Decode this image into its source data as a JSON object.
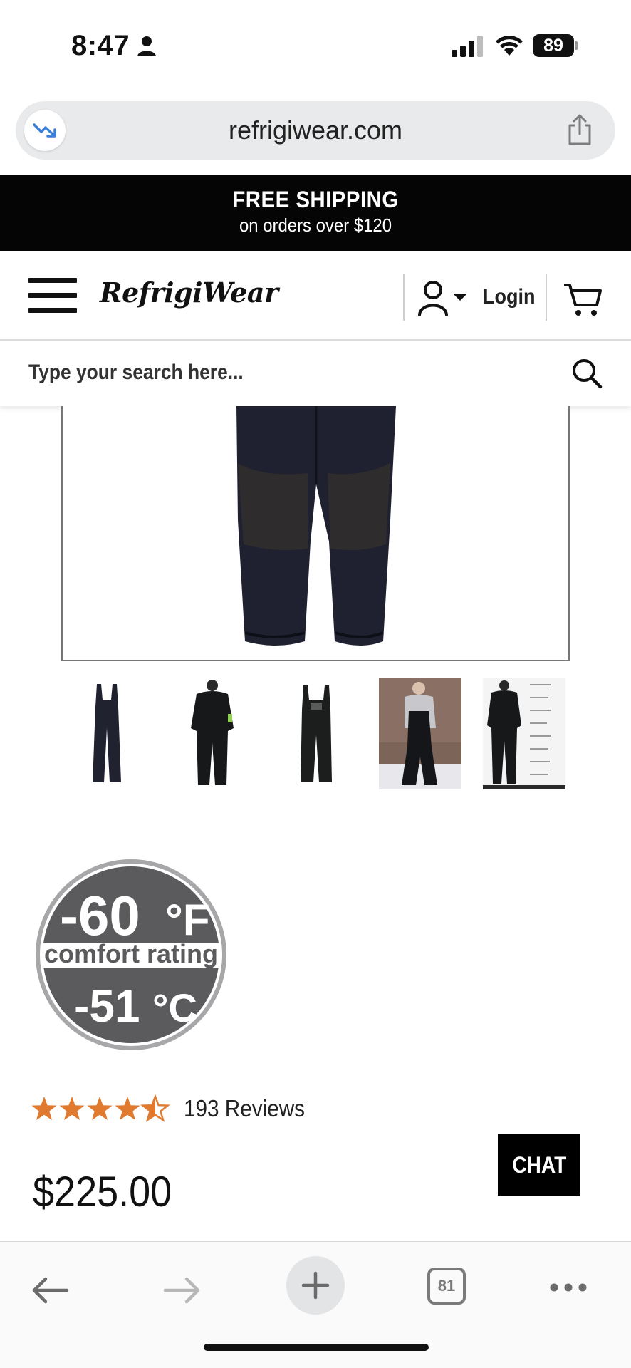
{
  "status_bar": {
    "time": "8:47",
    "battery": "89"
  },
  "browser": {
    "url": "refrigiwear.com",
    "tab_count": "81"
  },
  "promo": {
    "line1": "FREE SHIPPING",
    "line2": "on orders over $120"
  },
  "header": {
    "logo": "RefrigiWear",
    "login_label": "Login"
  },
  "search": {
    "placeholder": "Type your search here..."
  },
  "badge": {
    "fahrenheit": "-60",
    "f_unit": "°F",
    "label": "comfort rating",
    "celsius": "-51",
    "c_unit": "°C"
  },
  "product": {
    "rating": 4.5,
    "rating_max": 5,
    "reviews": "193 Reviews",
    "price": "$225.00"
  },
  "chat": {
    "label": "CHAT"
  },
  "colors": {
    "star": "#e07a2e",
    "banner_bg": "#050505",
    "badge_gray": "#5b5b5d"
  }
}
